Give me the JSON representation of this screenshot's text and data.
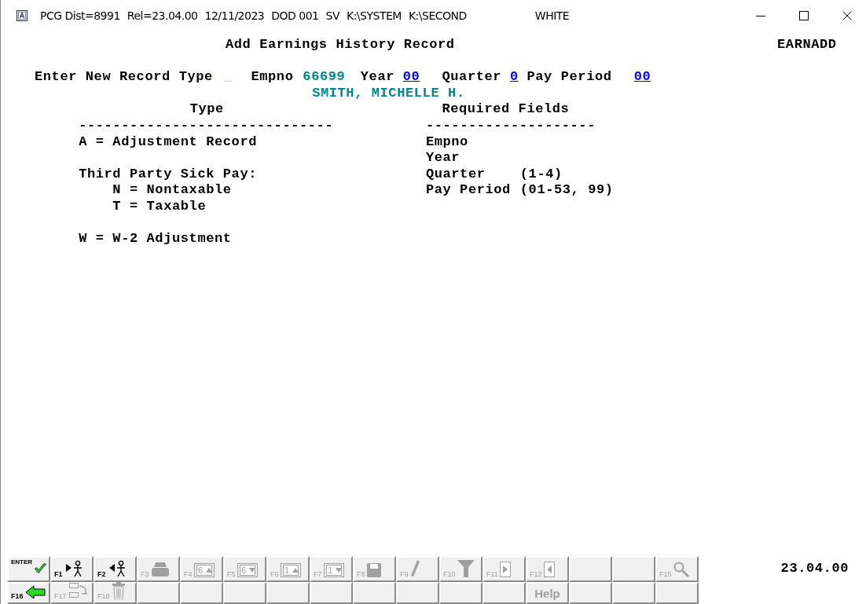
{
  "window": {
    "title_parts": [
      "PCG Dist=8991",
      "Rel=23.04.00",
      "12/11/2023",
      "DOD 001",
      "SV",
      "K:\\SYSTEM",
      "K:\\SECOND",
      "WHITE"
    ]
  },
  "screen": {
    "title": "Add Earnings History Record",
    "program": "EARNADD",
    "prompt": [
      {
        "kind": "label",
        "text": "Enter New Record Type"
      },
      {
        "kind": "cursor",
        "text": "_"
      },
      {
        "kind": "label",
        "text": "Empno"
      },
      {
        "kind": "display",
        "text": "66699"
      },
      {
        "kind": "label",
        "text": "Year"
      },
      {
        "kind": "input",
        "text": "00"
      },
      {
        "kind": "label",
        "text": "Quarter"
      },
      {
        "kind": "input",
        "text": "0"
      },
      {
        "kind": "label",
        "text": "Pay Period"
      },
      {
        "kind": "input",
        "text": "00"
      }
    ],
    "employee_name": "SMITH, MICHELLE H.",
    "type_heading": "Type",
    "type_rule": "------------------------------",
    "fields_heading": "Required Fields",
    "fields_rule": "--------------------",
    "type_codes": [
      {
        "text": "A = Adjustment Record"
      },
      {
        "text": "Third Party Sick Pay:",
        "children": [
          {
            "text": "N = Nontaxable"
          },
          {
            "text": "T = Taxable"
          }
        ]
      },
      {
        "text": "W = W-2 Adjustment"
      }
    ],
    "required_fields": [
      {
        "name": "Empno"
      },
      {
        "name": "Year"
      },
      {
        "name": "Quarter",
        "range": "(1-4)"
      },
      {
        "name": "Pay Period",
        "range": "(01-53, 99)"
      }
    ]
  },
  "function_keys": [
    [
      {
        "kind": "check",
        "label": "ENTER",
        "disabled": false
      },
      {
        "kind": "walkright",
        "label": "F1",
        "disabled": false
      },
      {
        "kind": "walkleft",
        "label": "F2",
        "disabled": false
      },
      {
        "kind": "print",
        "label": "F3",
        "disabled": true
      },
      {
        "kind": "pageup",
        "label": "F4",
        "glyph": "6",
        "disabled": true
      },
      {
        "kind": "pagedown",
        "label": "F5",
        "glyph": "6",
        "disabled": true
      },
      {
        "kind": "pageup",
        "label": "F6",
        "glyph": "1",
        "disabled": true
      },
      {
        "kind": "pagedown",
        "label": "F7",
        "glyph": "1",
        "disabled": true
      },
      {
        "kind": "save",
        "label": "F8",
        "disabled": true
      },
      {
        "kind": "pencil",
        "label": "F9",
        "disabled": true
      },
      {
        "kind": "filter",
        "label": "F10",
        "disabled": true
      },
      {
        "kind": "next",
        "label": "F11",
        "disabled": true
      },
      {
        "kind": "prev",
        "label": "F12",
        "disabled": true
      },
      {
        "kind": "blank"
      },
      {
        "kind": "blank"
      },
      {
        "kind": "zoom",
        "label": "F15",
        "disabled": true
      }
    ],
    [
      {
        "kind": "back",
        "label": "F16",
        "disabled": false
      },
      {
        "kind": "move",
        "label": "F17",
        "disabled": true
      },
      {
        "kind": "trash",
        "label": "F18",
        "disabled": true
      },
      {
        "kind": "blank"
      },
      {
        "kind": "blank"
      },
      {
        "kind": "blank"
      },
      {
        "kind": "blank"
      },
      {
        "kind": "blank"
      },
      {
        "kind": "blank"
      },
      {
        "kind": "blank"
      },
      {
        "kind": "blank"
      },
      {
        "kind": "blank"
      },
      {
        "kind": "help",
        "text": "Help",
        "disabled": true
      },
      {
        "kind": "blank"
      },
      {
        "kind": "blank"
      },
      {
        "kind": "blank"
      }
    ]
  ],
  "version": "23.04.00"
}
